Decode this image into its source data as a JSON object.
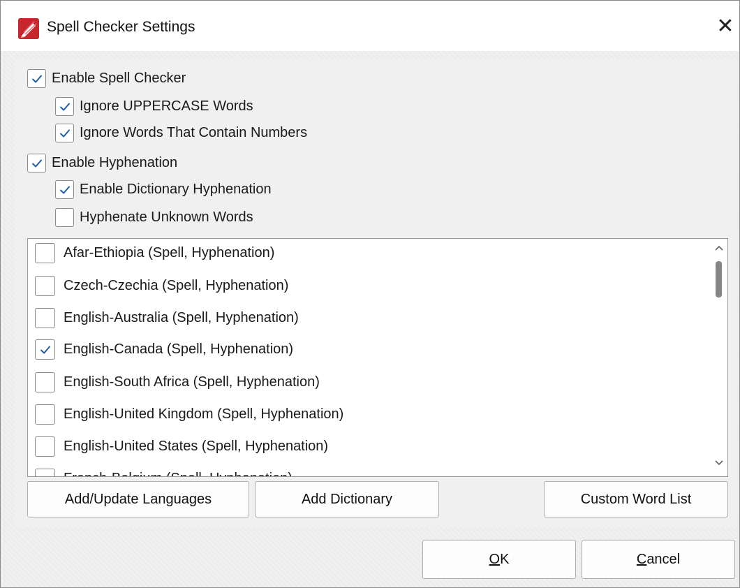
{
  "window": {
    "title": "Spell Checker Settings",
    "close_glyph": "✕",
    "app_icon": "pdf-xchange-pen-icon",
    "icon_color": "#c8262d"
  },
  "options": {
    "enable_spell_checker": {
      "label": "Enable Spell Checker",
      "checked": true
    },
    "ignore_uppercase": {
      "label": "Ignore UPPERCASE Words",
      "checked": true
    },
    "ignore_numbers": {
      "label": "Ignore Words That Contain Numbers",
      "checked": true
    },
    "enable_hyphenation": {
      "label": "Enable Hyphenation",
      "checked": true
    },
    "enable_dictionary_hyphenation": {
      "label": "Enable Dictionary Hyphenation",
      "checked": true
    },
    "hyphenate_unknown": {
      "label": "Hyphenate Unknown Words",
      "checked": false
    }
  },
  "languages": [
    {
      "label": "Afar-Ethiopia (Spell, Hyphenation)",
      "checked": false
    },
    {
      "label": "Czech-Czechia (Spell, Hyphenation)",
      "checked": false
    },
    {
      "label": "English-Australia (Spell, Hyphenation)",
      "checked": false
    },
    {
      "label": "English-Canada (Spell, Hyphenation)",
      "checked": true
    },
    {
      "label": "English-South Africa (Spell, Hyphenation)",
      "checked": false
    },
    {
      "label": "English-United Kingdom (Spell, Hyphenation)",
      "checked": false
    },
    {
      "label": "English-United States (Spell, Hyphenation)",
      "checked": false
    },
    {
      "label": "French-Belgium (Spell, Hyphenation)",
      "checked": false
    }
  ],
  "buttons": {
    "add_update_languages": "Add/Update Languages",
    "add_dictionary": "Add Dictionary",
    "custom_word_list": "Custom Word List",
    "ok_mnemonic": "O",
    "ok_rest": "K",
    "cancel_mnemonic": "C",
    "cancel_rest": "ancel"
  },
  "colors": {
    "check_color": "#1f5fa8",
    "dialog_bg": "#f0f0f0"
  }
}
